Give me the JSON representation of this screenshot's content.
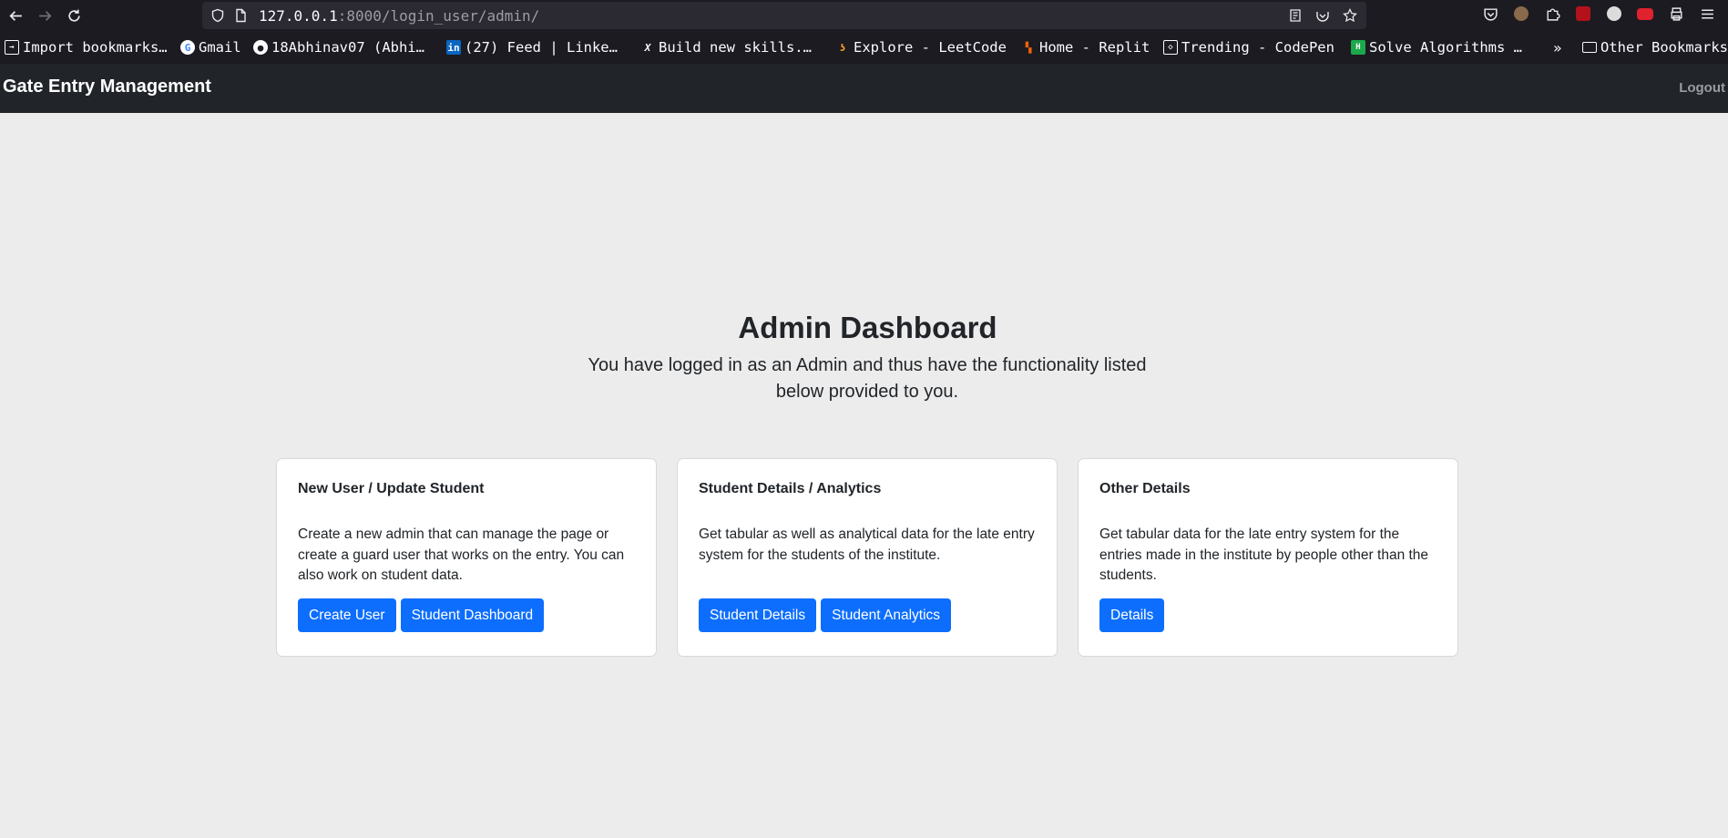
{
  "browser": {
    "url_host": "127.0.0.1",
    "url_rest": ":8000/login_user/admin/",
    "bookmarks": [
      {
        "label": "Import bookmarks…",
        "icon": "import-icon"
      },
      {
        "label": "Gmail",
        "icon": "google-icon"
      },
      {
        "label": "18Abhinav07 (Abhi…",
        "icon": "github-icon"
      },
      {
        "label": "(27) Feed | Linke…",
        "icon": "linkedin-icon"
      },
      {
        "label": "Build new skills.…",
        "icon": "x-icon"
      },
      {
        "label": "Explore - LeetCode",
        "icon": "leetcode-icon"
      },
      {
        "label": "Home - Replit",
        "icon": "replit-icon"
      },
      {
        "label": "Trending - CodePen",
        "icon": "codepen-icon"
      },
      {
        "label": "Solve Algorithms …",
        "icon": "hackerrank-icon"
      }
    ],
    "other_bookmarks": "Other Bookmarks"
  },
  "navbar": {
    "brand": "Gate Entry Management",
    "logout": "Logout"
  },
  "main": {
    "title": "Admin Dashboard",
    "subtitle": "You have logged in as an Admin and thus have the functionality listed below provided to you.",
    "cards": [
      {
        "title": "New User / Update Student",
        "text": "Create a new admin that can manage the page or create a guard user that works on the entry. You can also work on student data.",
        "buttons": [
          "Create User",
          "Student Dashboard"
        ]
      },
      {
        "title": "Student Details / Analytics",
        "text": "Get tabular as well as analytical data for the late entry system for the students of the institute.",
        "buttons": [
          "Student Details",
          "Student Analytics"
        ]
      },
      {
        "title": "Other Details",
        "text": "Get tabular data for the late entry system for the entries made in the institute by people other than the students.",
        "buttons": [
          "Details"
        ]
      }
    ]
  },
  "colors": {
    "navbar_bg": "#212529",
    "page_bg": "#ececec",
    "button_primary": "#0d6efd"
  }
}
